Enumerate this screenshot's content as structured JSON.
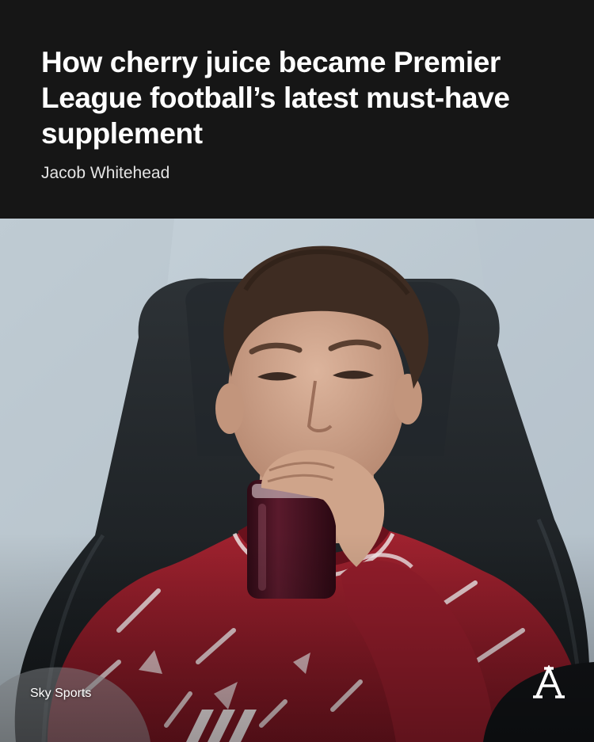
{
  "article": {
    "headline": "How cherry juice became Premier League football’s latest must-have supplement",
    "byline": "Jacob Whitehead"
  },
  "photo": {
    "subject": "footballer in red training top drinking dark red juice from a bottle while seated in a black stadium seat",
    "credit": "Sky Sports"
  },
  "brand": {
    "logo_icon": "athletic-a-logo-icon",
    "logo_letter": "A"
  },
  "colors": {
    "header_bg": "#161616",
    "headline_text": "#ffffff",
    "shirt_red": "#8e1c2a",
    "juice": "#3d0f1e"
  }
}
